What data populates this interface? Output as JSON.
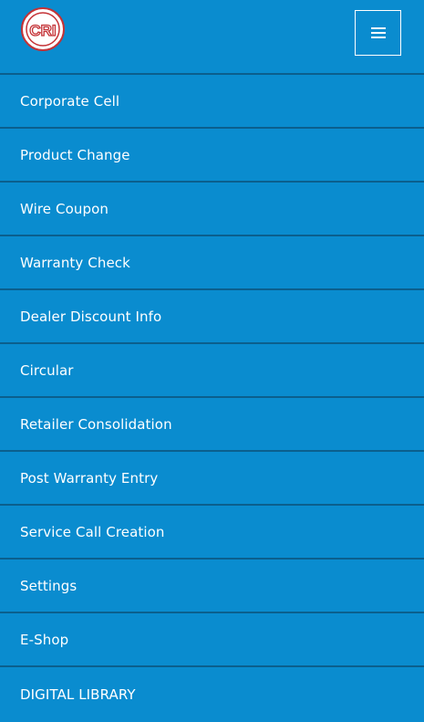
{
  "colors": {
    "background": "#0a8ccf",
    "divider": "#0b5f8d",
    "text": "#ffffff",
    "logo_red": "#c43236"
  },
  "header": {
    "logo_text": "CRI",
    "menu_icon": "hamburger-menu-icon"
  },
  "menu": {
    "items": [
      {
        "label": "Corporate Cell"
      },
      {
        "label": "Product Change"
      },
      {
        "label": "Wire Coupon"
      },
      {
        "label": "Warranty Check"
      },
      {
        "label": "Dealer Discount Info"
      },
      {
        "label": "Circular"
      },
      {
        "label": "Retailer Consolidation"
      },
      {
        "label": "Post Warranty Entry"
      },
      {
        "label": "Service Call Creation"
      },
      {
        "label": "Settings"
      },
      {
        "label": "E-Shop"
      },
      {
        "label": "DIGITAL LIBRARY"
      }
    ]
  }
}
